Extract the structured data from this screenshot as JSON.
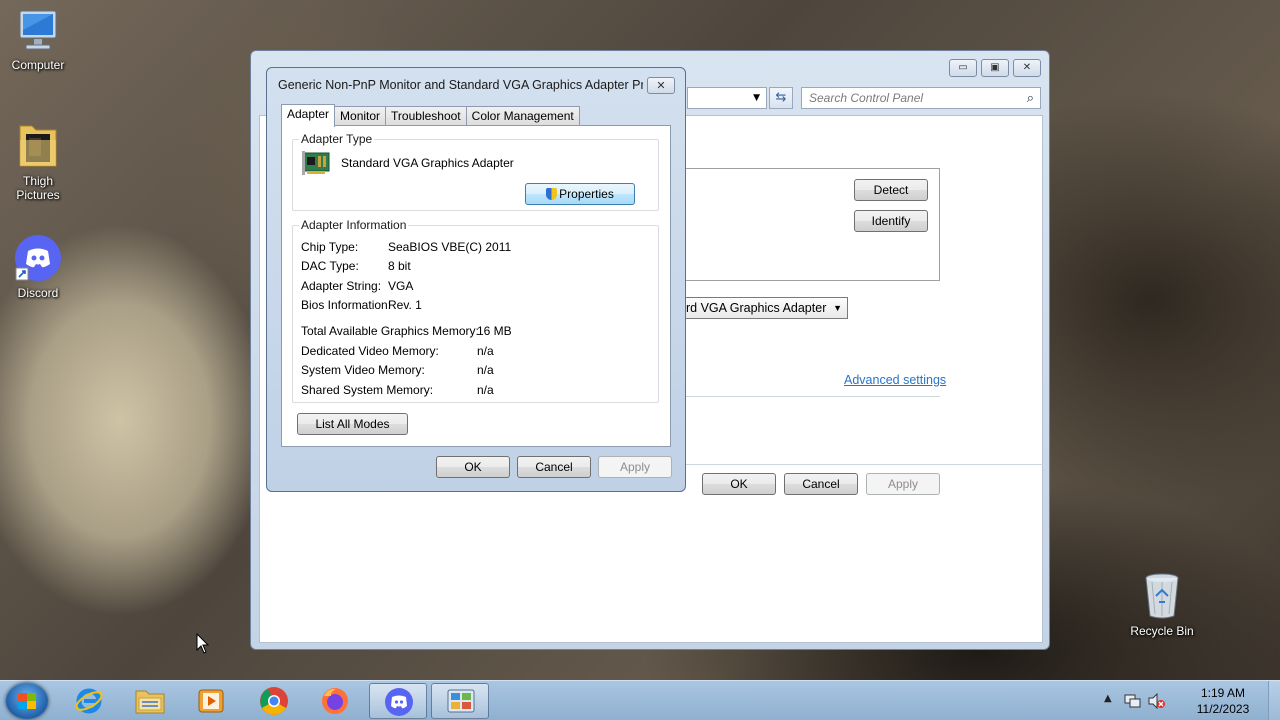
{
  "desktop": {
    "icons": [
      {
        "label": "Computer",
        "icon": "computer-icon"
      },
      {
        "label": "Thigh\nPictures",
        "label_line1": "Thigh",
        "label_line2": "Pictures",
        "icon": "folder-icon"
      },
      {
        "label": "Discord",
        "icon": "discord-icon"
      },
      {
        "label": "Recycle Bin",
        "icon": "recycle-bin-icon"
      }
    ]
  },
  "back_window": {
    "search_placeholder": "Search Control Panel",
    "detect_label": "Detect",
    "identify_label": "Identify",
    "display_dropdown_value": "rd VGA Graphics Adapter",
    "advanced_link": "Advanced settings",
    "ok_label": "OK",
    "cancel_label": "Cancel",
    "apply_label": "Apply",
    "minimize": "▭",
    "maximize": "▣",
    "close": "✕"
  },
  "dialog": {
    "title": "Generic Non-PnP Monitor and Standard VGA Graphics Adapter Pro...",
    "close": "✕",
    "tabs": [
      "Adapter",
      "Monitor",
      "Troubleshoot",
      "Color Management"
    ],
    "active_tab": "Adapter",
    "adapter_type": {
      "heading": "Adapter Type",
      "name": "Standard VGA Graphics Adapter",
      "properties_label": "Properties"
    },
    "adapter_info": {
      "heading": "Adapter Information",
      "rows": [
        {
          "label": "Chip Type:",
          "value": "SeaBIOS VBE(C) 2011"
        },
        {
          "label": "DAC Type:",
          "value": "8 bit"
        },
        {
          "label": "Adapter String:",
          "value": "VGA"
        },
        {
          "label": "Bios Information:",
          "value": "Rev. 1"
        }
      ],
      "memory_rows": [
        {
          "label": "Total Available Graphics Memory:",
          "value": "16 MB"
        },
        {
          "label": "Dedicated Video Memory:",
          "value": "n/a"
        },
        {
          "label": "System Video Memory:",
          "value": "n/a"
        },
        {
          "label": "Shared System Memory:",
          "value": "n/a"
        }
      ]
    },
    "list_modes_label": "List All Modes",
    "ok_label": "OK",
    "cancel_label": "Cancel",
    "apply_label": "Apply"
  },
  "taskbar": {
    "apps": [
      "internet-explorer-icon",
      "file-explorer-icon",
      "media-player-icon",
      "chrome-icon",
      "firefox-icon",
      "discord-icon",
      "control-panel-icon"
    ],
    "time": "1:19 AM",
    "date": "11/2/2023"
  },
  "colors": {
    "link": "#2a74c5",
    "taskbar": "#9dbbd9"
  }
}
